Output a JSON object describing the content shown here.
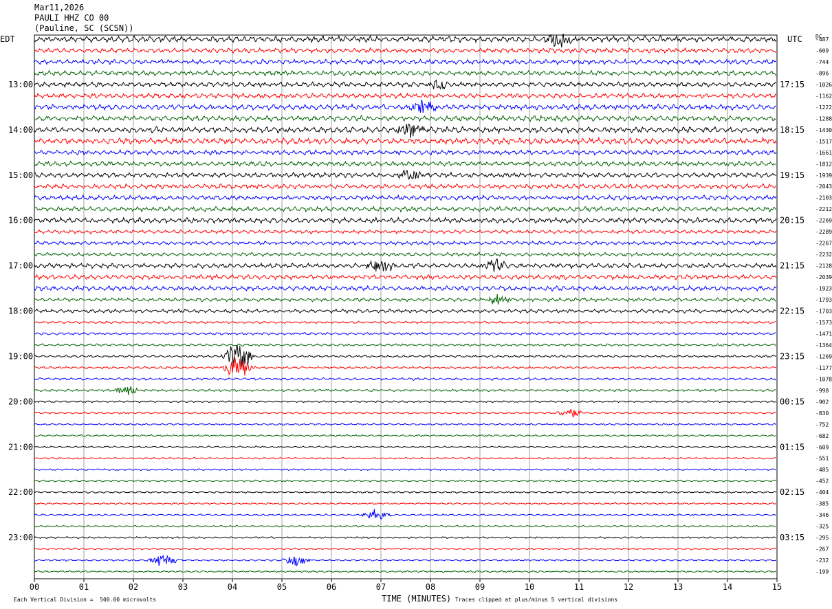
{
  "header": {
    "date": "Mar11,2026",
    "station": "PAULI HHZ CO 00",
    "location": "(Pauline, SC (SCSN))"
  },
  "left_zone_label": "EDT",
  "right_zone_label": "UTC",
  "dc_label": "DC",
  "footer": {
    "scale_note": "Each Vertical Division =  500.00 microvolts",
    "xlabel": "TIME (MINUTES)",
    "clip_note": "Traces clipped at plus/minus 5 vertical divisions"
  },
  "colors": {
    "trace_cycle": [
      "#000000",
      "#ff0000",
      "#0000ff",
      "#006400"
    ],
    "grid": "#888888",
    "frame": "#000000"
  },
  "chart_data": {
    "type": "line",
    "title": "",
    "xlabel": "TIME (MINUTES)",
    "ylabel": "",
    "x_ticks": [
      "00",
      "01",
      "02",
      "03",
      "04",
      "05",
      "06",
      "07",
      "08",
      "09",
      "10",
      "11",
      "12",
      "13",
      "14",
      "15"
    ],
    "xlim": [
      0,
      15
    ],
    "grid_vertical": true,
    "trace_count": 48,
    "left_hour_labels": [
      "13:00",
      "14:00",
      "15:00",
      "16:00",
      "17:00",
      "18:00",
      "19:00",
      "20:00",
      "21:00",
      "22:00",
      "23:00"
    ],
    "right_hour_labels": [
      "17:15",
      "18:15",
      "19:15",
      "20:15",
      "21:15",
      "22:15",
      "23:15",
      "00:15",
      "01:15",
      "02:15",
      "03:15"
    ],
    "hour_label_first_trace": 4,
    "dc_offsets": [
      "-487",
      "-609",
      "-744",
      "-896",
      "-1026",
      "-1162",
      "-1222",
      "-1288",
      "-1430",
      "-1517",
      "-1661",
      "-1812",
      "-1939",
      "-2043",
      "-2103",
      "-2212",
      "-2269",
      "-2289",
      "-2267",
      "-2232",
      "-2128",
      "-2039",
      "-1923",
      "-1793",
      "-1703",
      "-1573",
      "-1471",
      "-1364",
      "-1269",
      "-1177",
      "-1078",
      "-998",
      "-902",
      "-830",
      "-752",
      "-682",
      "-609",
      "-551",
      "-485",
      "-452",
      "-404",
      "-385",
      "-346",
      "-325",
      "-295",
      "-267",
      "-232",
      "-199"
    ],
    "trace_activity": [
      1.0,
      0.8,
      0.8,
      0.8,
      0.8,
      0.8,
      0.9,
      0.9,
      1.0,
      1.0,
      0.8,
      0.8,
      0.8,
      0.8,
      0.8,
      0.8,
      0.9,
      0.6,
      0.6,
      0.6,
      0.8,
      0.8,
      0.8,
      0.6,
      0.6,
      0.4,
      0.4,
      0.4,
      0.4,
      0.4,
      0.4,
      0.4,
      0.3,
      0.3,
      0.3,
      0.3,
      0.3,
      0.3,
      0.3,
      0.3,
      0.3,
      0.3,
      0.3,
      0.3,
      0.3,
      0.3,
      0.3,
      0.3
    ],
    "events": [
      {
        "trace": 0,
        "minute": 10.6,
        "amp": 2.0
      },
      {
        "trace": 4,
        "minute": 8.2,
        "amp": 1.5
      },
      {
        "trace": 6,
        "minute": 7.9,
        "amp": 1.8
      },
      {
        "trace": 8,
        "minute": 7.6,
        "amp": 1.7
      },
      {
        "trace": 12,
        "minute": 7.6,
        "amp": 1.5
      },
      {
        "trace": 20,
        "minute": 7.0,
        "amp": 1.8
      },
      {
        "trace": 20,
        "minute": 9.3,
        "amp": 1.5
      },
      {
        "trace": 23,
        "minute": 9.4,
        "amp": 1.5
      },
      {
        "trace": 28,
        "minute": 4.1,
        "amp": 4.5
      },
      {
        "trace": 29,
        "minute": 4.1,
        "amp": 3.5
      },
      {
        "trace": 31,
        "minute": 1.9,
        "amp": 1.4
      },
      {
        "trace": 33,
        "minute": 10.8,
        "amp": 1.4
      },
      {
        "trace": 42,
        "minute": 6.9,
        "amp": 1.5
      },
      {
        "trace": 46,
        "minute": 2.6,
        "amp": 2.0
      },
      {
        "trace": 46,
        "minute": 5.3,
        "amp": 1.5
      }
    ]
  }
}
